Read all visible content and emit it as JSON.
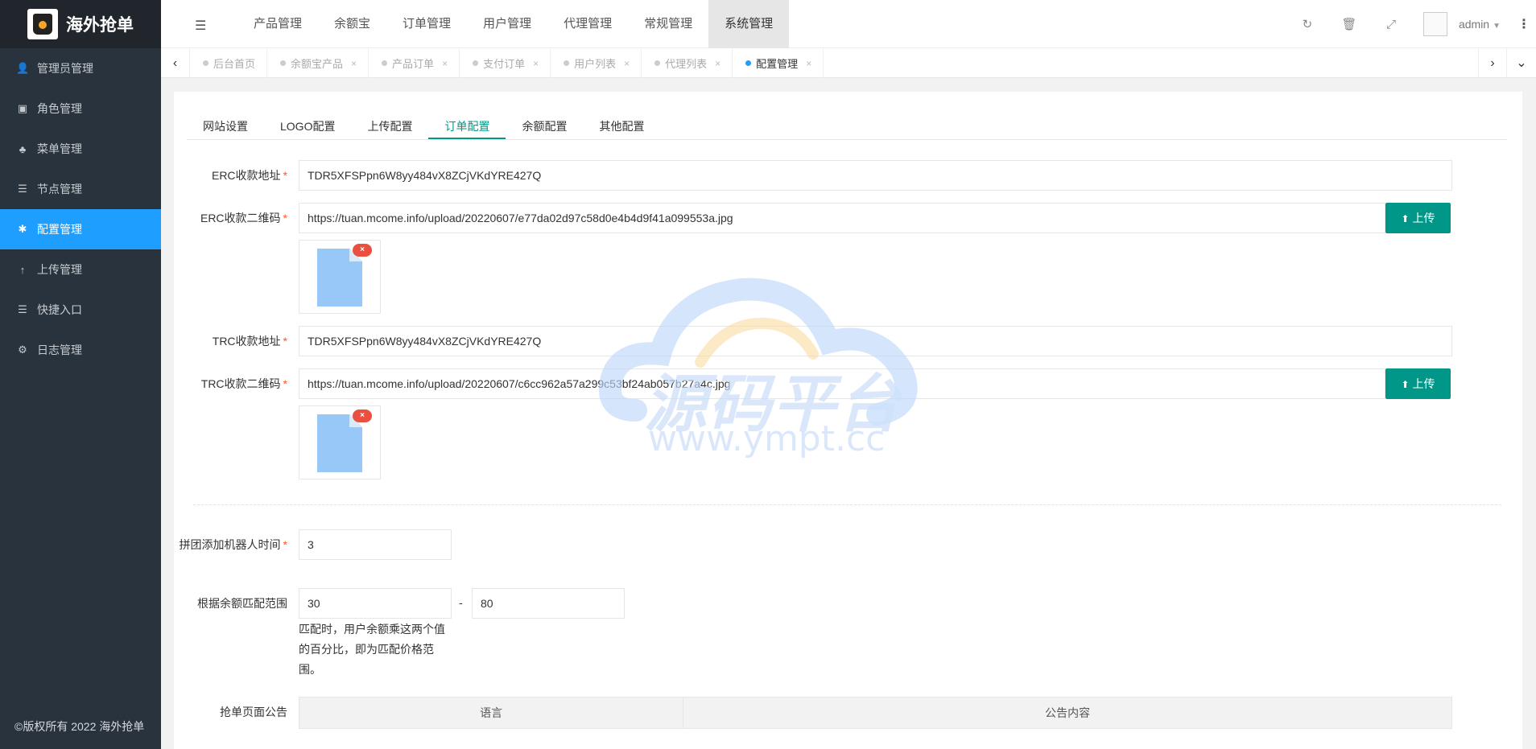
{
  "brand": {
    "title": "海外抢单"
  },
  "sidebar": {
    "items": [
      {
        "label": "管理员管理",
        "icon": "user-icon",
        "glyph": "👤"
      },
      {
        "label": "角色管理",
        "icon": "role-icon",
        "glyph": "▣"
      },
      {
        "label": "菜单管理",
        "icon": "tree-icon",
        "glyph": "♣"
      },
      {
        "label": "节点管理",
        "icon": "list-icon",
        "glyph": "☰"
      },
      {
        "label": "配置管理",
        "icon": "asterisk-icon",
        "glyph": "✱"
      },
      {
        "label": "上传管理",
        "icon": "arrow-up-icon",
        "glyph": "↑"
      },
      {
        "label": "快捷入口",
        "icon": "list-icon",
        "glyph": "☰"
      },
      {
        "label": "日志管理",
        "icon": "gear-icon",
        "glyph": "⚙"
      }
    ],
    "active_index": 4,
    "copyright": "©版权所有 2022 海外抢单"
  },
  "topbar": {
    "menu": [
      "产品管理",
      "余额宝",
      "订单管理",
      "用户管理",
      "代理管理",
      "常规管理",
      "系统管理"
    ],
    "active_menu": "系统管理",
    "user": "admin"
  },
  "tabs": [
    {
      "label": "后台首页",
      "closable": false
    },
    {
      "label": "余额宝产品",
      "closable": true
    },
    {
      "label": "产品订单",
      "closable": true
    },
    {
      "label": "支付订单",
      "closable": true
    },
    {
      "label": "用户列表",
      "closable": true
    },
    {
      "label": "代理列表",
      "closable": true
    },
    {
      "label": "配置管理",
      "closable": true
    }
  ],
  "config_tabs": [
    "网站设置",
    "LOGO配置",
    "上传配置",
    "订单配置",
    "余额配置",
    "其他配置"
  ],
  "active_config_tab": "订单配置",
  "form": {
    "erc_address_label": "ERC收款地址",
    "erc_address_value": "TDR5XFSPpn6W8yy484vX8ZCjVKdYRE427Q",
    "erc_qr_label": "ERC收款二维码",
    "erc_qr_value": "https://tuan.mcome.info/upload/20220607/e77da02d97c58d0e4b4d9f41a099553a.jpg",
    "trc_address_label": "TRC收款地址",
    "trc_address_value": "TDR5XFSPpn6W8yy484vX8ZCjVKdYRE427Q",
    "trc_qr_label": "TRC收款二维码",
    "trc_qr_value": "https://tuan.mcome.info/upload/20220607/c6cc962a57a299c53bf24ab057b27a4c.jpg",
    "upload_label": "上传",
    "robot_time_label": "拼团添加机器人时间",
    "robot_time_value": "3",
    "match_range_label": "根据余额匹配范围",
    "match_min": "30",
    "match_max": "80",
    "range_separator": "-",
    "match_hint": "匹配时，用户余额乘这两个值的百分比，即为匹配价格范围。",
    "notice_label": "抢单页面公告",
    "notice_table": {
      "columns": [
        "语言",
        "公告内容"
      ]
    }
  },
  "watermark": {
    "text": "源码平台",
    "url": "www.ympt.cc"
  },
  "colors": {
    "sidebar": "#28333e",
    "active": "#1e9fff",
    "primary": "#009688",
    "required": "#ff5722"
  }
}
